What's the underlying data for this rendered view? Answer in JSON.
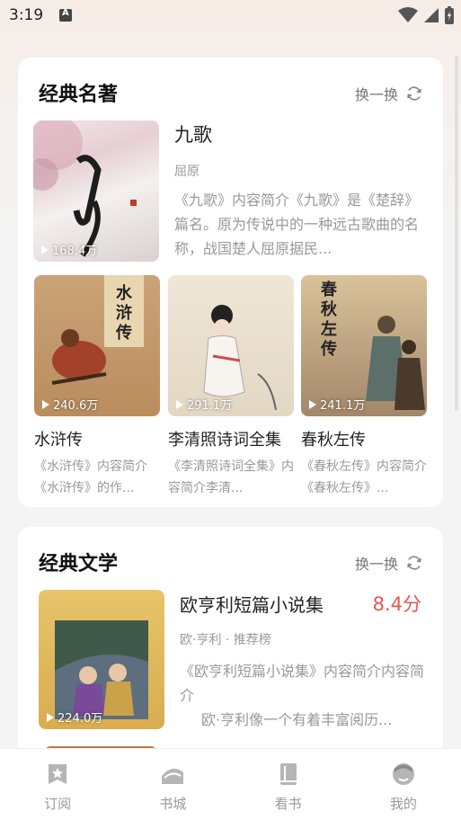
{
  "status_bar": {
    "time": "3:19"
  },
  "section_classics": {
    "title": "经典名著",
    "refresh_label": "换一换",
    "featured": {
      "title": "九歌",
      "author": "屈原",
      "description": "《九歌》内容简介《九歌》是《楚辞》篇名。原为传说中的一种远古歌曲的名称，战国楚人屈原据民...",
      "play_count": "168.4万"
    },
    "grid": [
      {
        "title": "水浒传",
        "description": "《水浒传》内容简介《水浒传》的作...",
        "play_count": "240.6万"
      },
      {
        "title": "李清照诗词全集",
        "description": "《李清照诗词全集》内容简介李清...",
        "play_count": "291.1万"
      },
      {
        "title": "春秋左传",
        "description": "《春秋左传》内容简介《春秋左传》...",
        "play_count": "241.1万"
      }
    ]
  },
  "section_literature": {
    "title": "经典文学",
    "refresh_label": "换一换",
    "featured": {
      "title": "欧亨利短篇小说集",
      "score": "8.4分",
      "meta": "欧·亨利 · 推荐榜",
      "description_line1": "《欧亨利短篇小说集》内容简介内容简介",
      "description_line2": "欧·亨利像一个有着丰富阅历...",
      "play_count": "224.0万"
    }
  },
  "bottom_nav": [
    {
      "label": "订阅",
      "icon": "subscribe-star-icon"
    },
    {
      "label": "书城",
      "icon": "bookstore-icon"
    },
    {
      "label": "看书",
      "icon": "read-book-icon"
    },
    {
      "label": "我的",
      "icon": "profile-icon"
    }
  ],
  "colors": {
    "score_red": "#e8554e",
    "muted_text": "#999999",
    "nav_icon": "#b5b5b5"
  }
}
